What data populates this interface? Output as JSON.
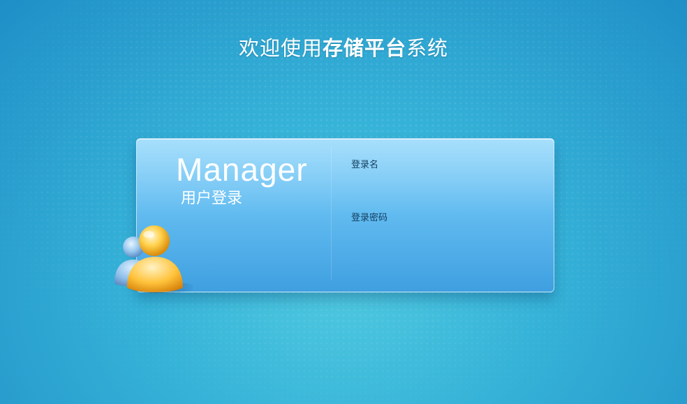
{
  "page": {
    "title_prefix": "欢迎使用",
    "title_brand": "存储平台",
    "title_suffix": "系统"
  },
  "login": {
    "heading": "Manager",
    "subheading": "用户登录",
    "username_label": "登录名",
    "username_value": "",
    "password_label": "登录密码",
    "password_value": ""
  },
  "icons": {
    "users": "users-icon",
    "background": "world-map-dots"
  },
  "colors": {
    "background_top": "#1f8fc7",
    "background_center": "#4fc9e0",
    "panel_top": "#8fd6fb",
    "panel_bottom": "#3f9fe0",
    "label_text": "#123d5e",
    "title_text": "#ffffff"
  }
}
